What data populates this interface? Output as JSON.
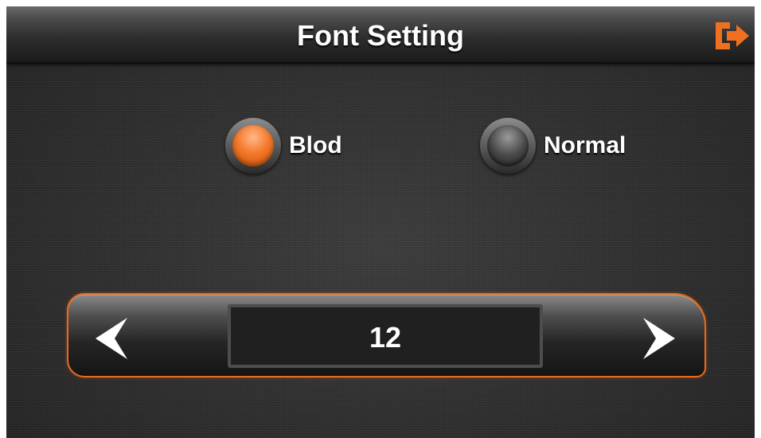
{
  "header": {
    "title": "Font Setting",
    "exit_icon": "exit-icon",
    "accent_color": "#f07020"
  },
  "font_style": {
    "options": [
      {
        "label": "Blod",
        "selected": true
      },
      {
        "label": "Normal",
        "selected": false
      }
    ]
  },
  "font_size": {
    "value": "12",
    "prev_icon": "arrow-left-icon",
    "next_icon": "arrow-right-icon"
  }
}
